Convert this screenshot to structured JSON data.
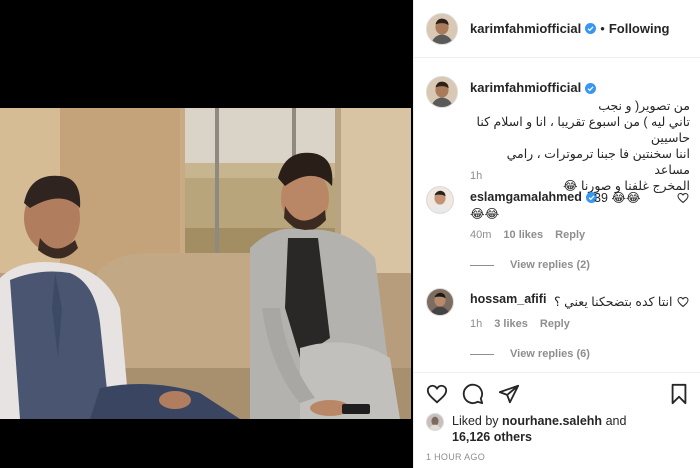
{
  "post": {
    "username": "karimfahmiofficial",
    "follow_state": "Following",
    "separator": "•"
  },
  "caption": {
    "username": "karimfahmiofficial",
    "lines": [
      "من تصوير( و نجب",
      "تاني ليه ) من اسبوع تقريبا ، انا و اسلام كنا حاسيين",
      "اننا سخنتين فا جبنا ترموترات ، رامي مساعد",
      "المخرج غلفنا و صورنا 😂"
    ],
    "time": "1h"
  },
  "comments": [
    {
      "username": "eslamgamalahmed",
      "text_line1": "39 😂😂",
      "text_line2": "😂😂",
      "time": "40m",
      "likes": "10 likes",
      "reply": "Reply",
      "view_replies": "View replies (2)"
    },
    {
      "username": "hossam_afifi",
      "text_line1": "انتا كده بتضحكنا يعني ؟",
      "time": "1h",
      "likes": "3 likes",
      "reply": "Reply",
      "view_replies": "View replies (6)"
    }
  ],
  "likes": {
    "prefix": "Liked by",
    "user": "nourhane.salehh",
    "suffix": "and",
    "others": "16,126 others"
  },
  "timestamp": "1 HOUR AGO",
  "icons": {
    "verified": "verified-badge-icon",
    "like": "heart-icon",
    "comment": "comment-bubble-icon",
    "share": "paper-plane-icon",
    "save": "bookmark-icon"
  },
  "colors": {
    "verified_blue": "#3897f0",
    "muted": "#8e8e8e",
    "text": "#262626"
  }
}
